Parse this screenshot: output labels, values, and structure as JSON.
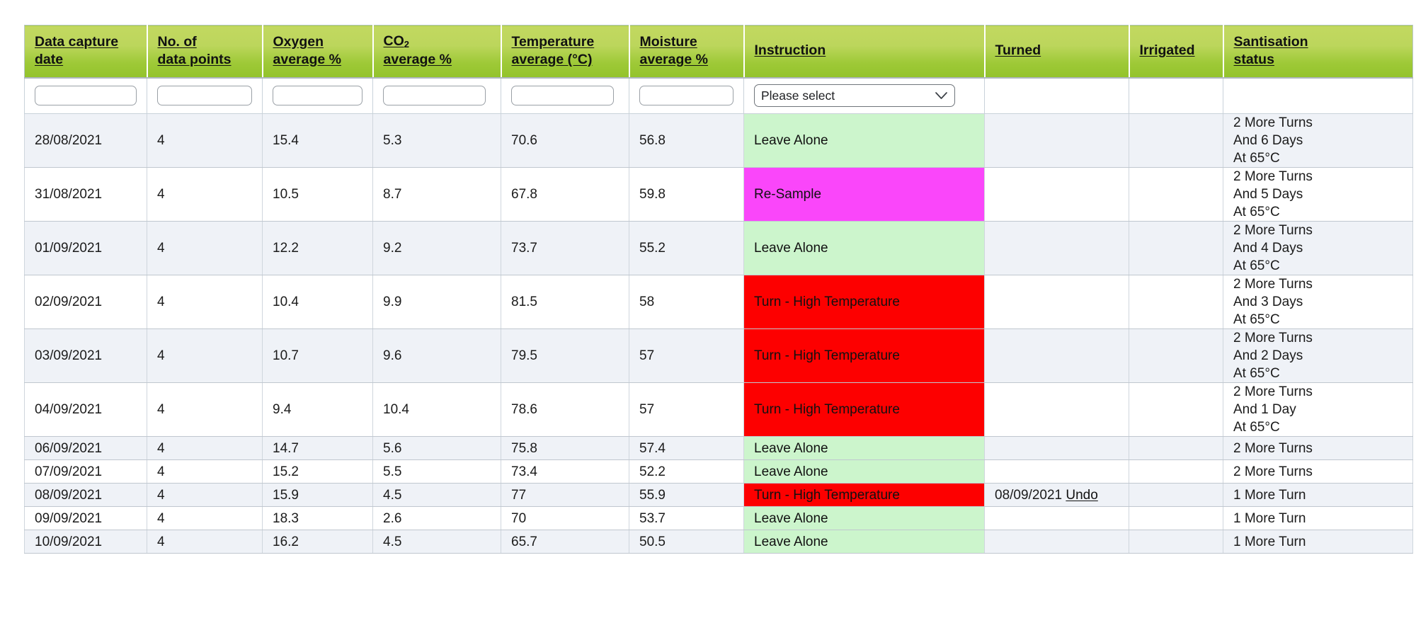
{
  "table": {
    "columns": [
      {
        "key": "date",
        "label": "Data capture\ndate",
        "sortable": true
      },
      {
        "key": "points",
        "label": "No. of \ndata points",
        "sortable": true
      },
      {
        "key": "oxygen",
        "label": "Oxygen \naverage %",
        "sortable": true
      },
      {
        "key": "co2",
        "label": "CO2 \naverage %",
        "sortable": true,
        "has_subscript": true,
        "sub_prefix": "CO",
        "sub_char": "2",
        "sub_suffix": " \naverage %"
      },
      {
        "key": "temperature",
        "label": "Temperature \naverage (°C)",
        "sortable": true
      },
      {
        "key": "moisture",
        "label": "Moisture \naverage %",
        "sortable": true
      },
      {
        "key": "instruction",
        "label": "Instruction",
        "sortable": true
      },
      {
        "key": "turned",
        "label": "Turned",
        "sortable": true
      },
      {
        "key": "irrigated",
        "label": "Irrigated",
        "sortable": true
      },
      {
        "key": "sanitisation",
        "label": "Santisation \nstatus",
        "sortable": true
      }
    ],
    "filters": {
      "date": {
        "value": "",
        "placeholder": ""
      },
      "points": {
        "value": "",
        "placeholder": ""
      },
      "oxygen": {
        "value": "",
        "placeholder": ""
      },
      "co2": {
        "value": "",
        "placeholder": ""
      },
      "temperature": {
        "value": "",
        "placeholder": ""
      },
      "moisture": {
        "value": "",
        "placeholder": ""
      },
      "instruction_select": {
        "value": "Please select",
        "options": [
          "Please select",
          "Leave Alone",
          "Re-Sample",
          "Turn - High Temperature"
        ]
      },
      "turned": {
        "value": ""
      },
      "irrigated": {
        "value": ""
      },
      "sanitisation": {
        "value": ""
      }
    },
    "rows": [
      {
        "date": "28/08/2021",
        "points": "4",
        "oxygen": "15.4",
        "co2": "5.3",
        "temperature": "70.6",
        "moisture": "56.8",
        "instruction": "Leave Alone",
        "instruction_state": "leave",
        "turned": "",
        "turned_undo": "",
        "irrigated": "",
        "sanitisation": "2 More Turns\nAnd 6 Days\nAt 65°C",
        "height": "tall",
        "stripe": "zebra"
      },
      {
        "date": "31/08/2021",
        "points": "4",
        "oxygen": "10.5",
        "co2": "8.7",
        "temperature": "67.8",
        "moisture": "59.8",
        "instruction": "Re-Sample",
        "instruction_state": "resample",
        "turned": "",
        "turned_undo": "",
        "irrigated": "",
        "sanitisation": "2 More Turns\nAnd 5 Days\nAt 65°C",
        "height": "tall",
        "stripe": "plain"
      },
      {
        "date": "01/09/2021",
        "points": "4",
        "oxygen": "12.2",
        "co2": "9.2",
        "temperature": "73.7",
        "moisture": "55.2",
        "instruction": "Leave Alone",
        "instruction_state": "leave",
        "turned": "",
        "turned_undo": "",
        "irrigated": "",
        "sanitisation": "2 More Turns\nAnd 4 Days\nAt 65°C",
        "height": "tall",
        "stripe": "zebra"
      },
      {
        "date": "02/09/2021",
        "points": "4",
        "oxygen": "10.4",
        "co2": "9.9",
        "temperature": "81.5",
        "moisture": "58",
        "instruction": "Turn - High Temperature",
        "instruction_state": "turn",
        "turned": "",
        "turned_undo": "",
        "irrigated": "",
        "sanitisation": "2 More Turns\nAnd 3 Days\nAt 65°C",
        "height": "tall",
        "stripe": "plain"
      },
      {
        "date": "03/09/2021",
        "points": "4",
        "oxygen": "10.7",
        "co2": "9.6",
        "temperature": "79.5",
        "moisture": "57",
        "instruction": "Turn - High Temperature",
        "instruction_state": "turn",
        "turned": "",
        "turned_undo": "",
        "irrigated": "",
        "sanitisation": "2 More Turns\nAnd 2 Days\nAt 65°C",
        "height": "tall",
        "stripe": "zebra"
      },
      {
        "date": "04/09/2021",
        "points": "4",
        "oxygen": "9.4",
        "co2": "10.4",
        "temperature": "78.6",
        "moisture": "57",
        "instruction": "Turn - High Temperature",
        "instruction_state": "turn",
        "turned": "",
        "turned_undo": "",
        "irrigated": "",
        "sanitisation": "2 More Turns\nAnd 1 Day\nAt 65°C",
        "height": "tall",
        "stripe": "plain"
      },
      {
        "date": "06/09/2021",
        "points": "4",
        "oxygen": "14.7",
        "co2": "5.6",
        "temperature": "75.8",
        "moisture": "57.4",
        "instruction": "Leave Alone",
        "instruction_state": "leave",
        "turned": "",
        "turned_undo": "",
        "irrigated": "",
        "sanitisation": "2 More Turns",
        "height": "short",
        "stripe": "zebra"
      },
      {
        "date": "07/09/2021",
        "points": "4",
        "oxygen": "15.2",
        "co2": "5.5",
        "temperature": "73.4",
        "moisture": "52.2",
        "instruction": "Leave Alone",
        "instruction_state": "leave",
        "turned": "",
        "turned_undo": "",
        "irrigated": "",
        "sanitisation": "2 More Turns",
        "height": "short",
        "stripe": "plain"
      },
      {
        "date": "08/09/2021",
        "points": "4",
        "oxygen": "15.9",
        "co2": "4.5",
        "temperature": "77",
        "moisture": "55.9",
        "instruction": "Turn - High Temperature",
        "instruction_state": "turn",
        "turned": "08/09/2021",
        "turned_undo": "Undo",
        "irrigated": "",
        "sanitisation": "1 More Turn",
        "height": "short",
        "stripe": "zebra"
      },
      {
        "date": "09/09/2021",
        "points": "4",
        "oxygen": "18.3",
        "co2": "2.6",
        "temperature": "70",
        "moisture": "53.7",
        "instruction": "Leave Alone",
        "instruction_state": "leave",
        "turned": "",
        "turned_undo": "",
        "irrigated": "",
        "sanitisation": "1 More Turn",
        "height": "short",
        "stripe": "plain"
      },
      {
        "date": "10/09/2021",
        "points": "4",
        "oxygen": "16.2",
        "co2": "4.5",
        "temperature": "65.7",
        "moisture": "50.5",
        "instruction": "Leave Alone",
        "instruction_state": "leave",
        "turned": "",
        "turned_undo": "",
        "irrigated": "",
        "sanitisation": "1 More Turn",
        "height": "short",
        "stripe": "zebra"
      }
    ]
  },
  "colors": {
    "header_green_top": "#c2d860",
    "header_green_bottom": "#93c32b",
    "leave_alone": "#ccf5cc",
    "re_sample": "#fa46fa",
    "turn_high_temperature": "#fd0000",
    "zebra_row": "#eff2f7",
    "plain_row": "#ffffff",
    "border": "#c0c7cf"
  }
}
